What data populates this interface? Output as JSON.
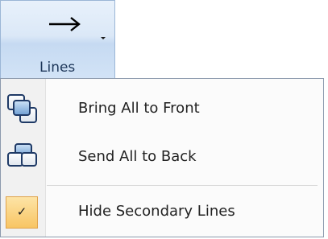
{
  "ribbon": {
    "button_label": "Lines",
    "icon": "arrow-right-icon"
  },
  "menu": {
    "items": [
      {
        "label": "Bring All to Front",
        "icon": "bring-to-front-icon"
      },
      {
        "label": "Send All to Back",
        "icon": "send-to-back-icon"
      },
      {
        "label": "Hide Secondary Lines",
        "icon": "check-icon",
        "checked": true,
        "check_glyph": "✓"
      }
    ]
  },
  "colors": {
    "ribbon_border": "#9bb6d6",
    "ribbon_label": "#1d3659",
    "checked_highlight": "#f8c564",
    "checked_border": "#e0a24a"
  }
}
